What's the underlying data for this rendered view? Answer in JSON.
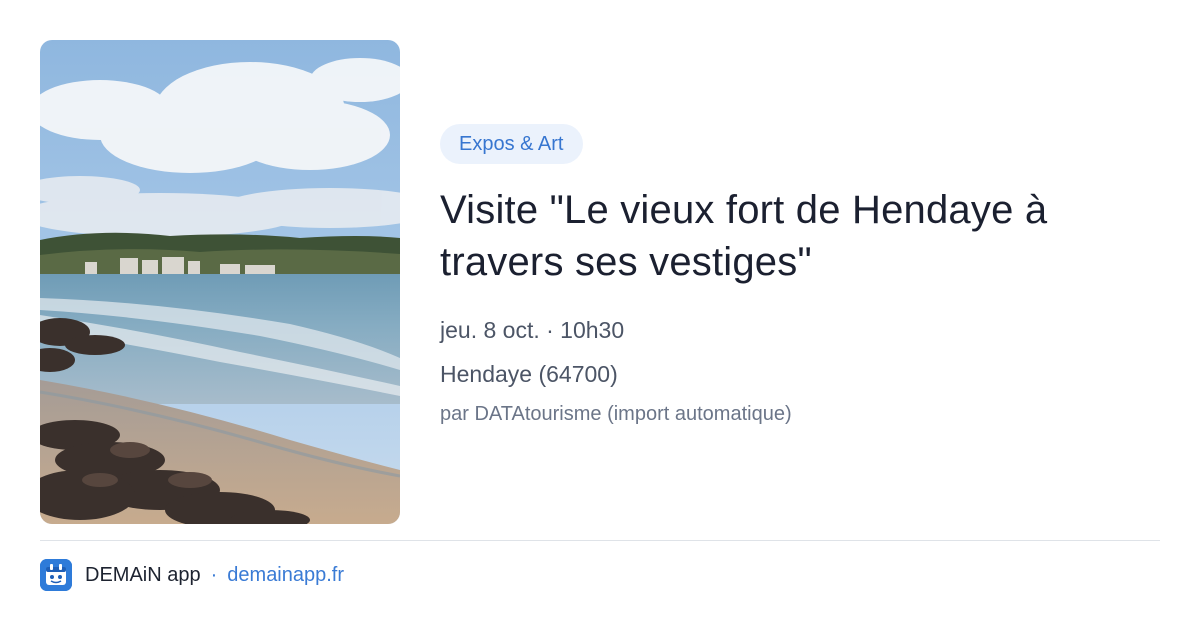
{
  "event": {
    "category": "Expos & Art",
    "title": "Visite \"Le vieux fort de Hendaye à travers ses vestiges\"",
    "date_time": "jeu. 8 oct. · 10h30",
    "location": "Hendaye (64700)",
    "source": "par DATAtourisme (import automatique)",
    "image_alt": "Plage de Hendaye avec rochers, mer et ciel nuageux"
  },
  "footer": {
    "app_name": "DEMAiN app",
    "separator": "·",
    "link": "demainapp.fr"
  },
  "icons": {
    "logo": "demain-app-logo-icon"
  },
  "colors": {
    "accent": "#3a7bd5",
    "badge_bg": "#ebf2fc",
    "logo_bg": "#2e7bd9"
  }
}
